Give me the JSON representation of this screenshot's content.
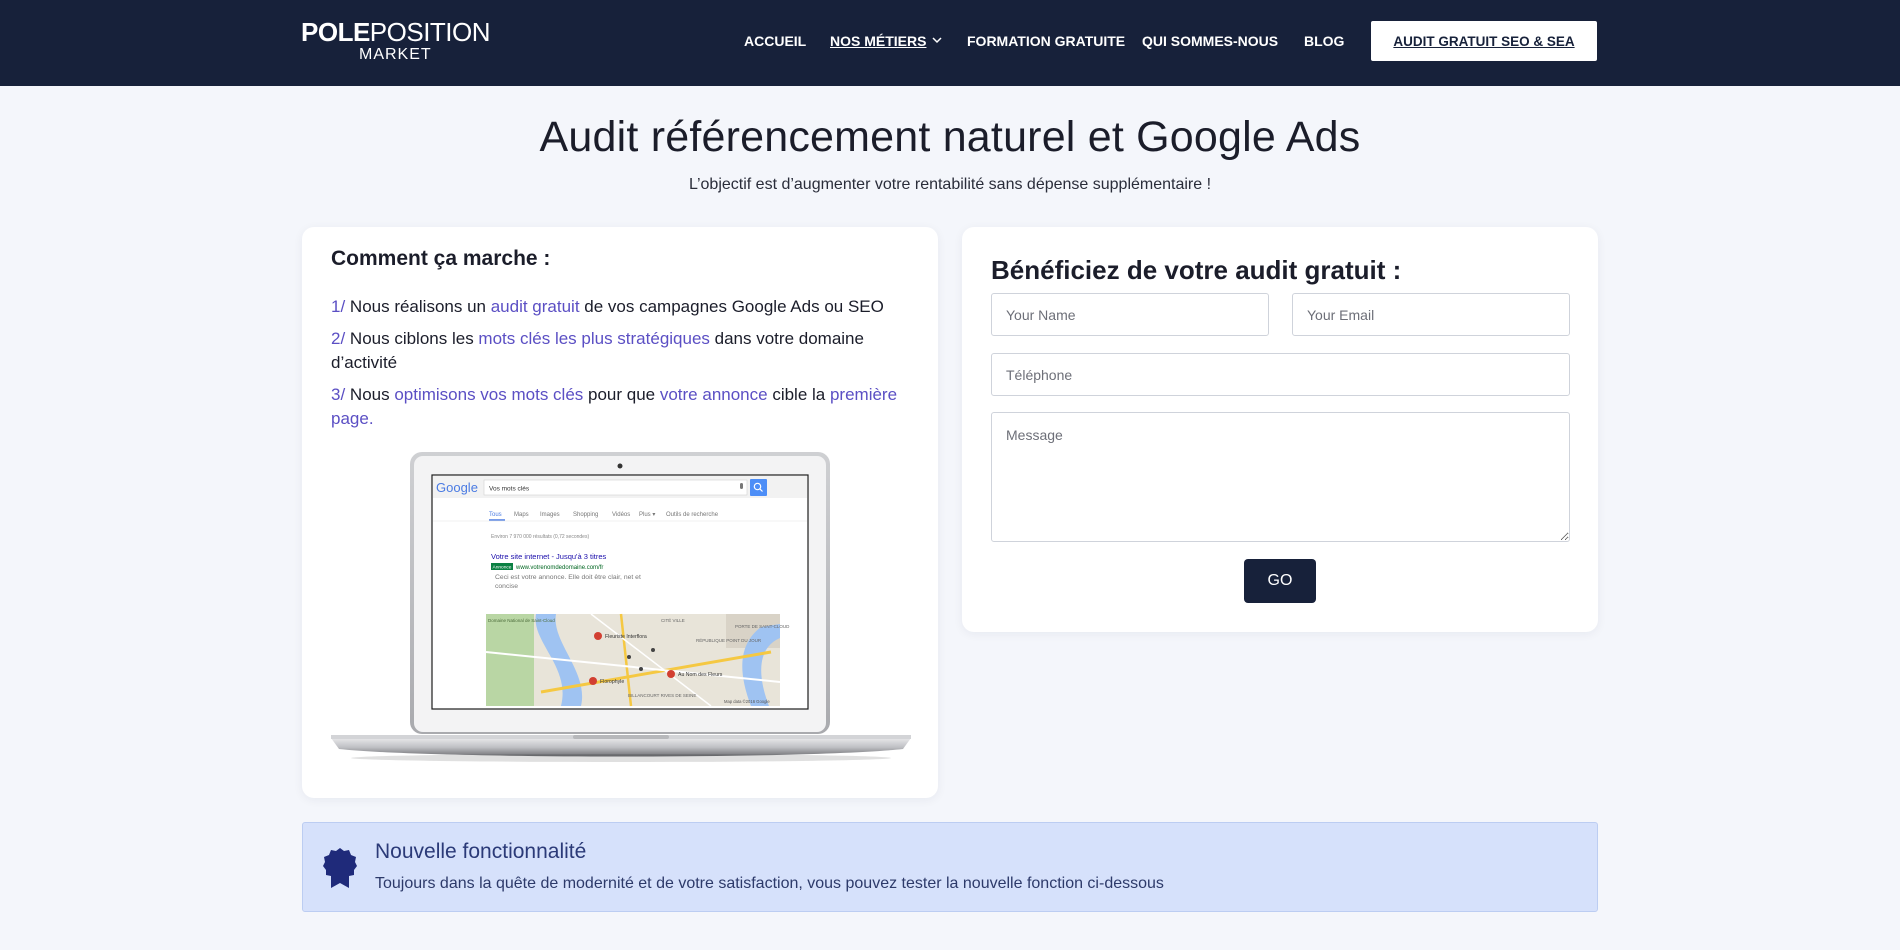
{
  "header": {
    "logo": {
      "line1_bold": "POLE",
      "line1_regular": "POSITION",
      "line2": "MARKET"
    },
    "nav": [
      {
        "label": "ACCUEIL"
      },
      {
        "label": "NOS MÉTIERS"
      },
      {
        "label": "FORMATION GRATUITE"
      },
      {
        "label": "QUI SOMMES-NOUS"
      },
      {
        "label": "BLOG"
      }
    ],
    "cta_label": "AUDIT GRATUIT SEO & SEA"
  },
  "hero": {
    "title": "Audit référencement naturel et Google Ads",
    "subtitle": "L’objectif est d’augmenter votre rentabilité sans dépense supplémentaire !"
  },
  "how": {
    "title": "Comment ça marche :",
    "step1": {
      "num": "1/",
      "a": " Nous réalisons un ",
      "b": "audit gratuit",
      "c": " de vos campagnes Google Ads ou SEO"
    },
    "step2": {
      "num": "2/",
      "a": " Nous ciblons les ",
      "b": "mots clés les plus stratégiques",
      "c": " dans votre domaine d’activité"
    },
    "step3": {
      "num": "3/",
      "a": " Nous ",
      "b": "optimisons vos mots clés",
      "c": " pour que ",
      "d": "votre annonce",
      "e": " cible la ",
      "f": "première page."
    }
  },
  "laptop_screen": {
    "google_logo": "Google",
    "search_value": "Vos mots clés",
    "tabs": [
      "Tous",
      "Maps",
      "Images",
      "Shopping",
      "Vidéos",
      "Plus ▾",
      "Outils de recherche"
    ],
    "results_count": "Environ 7 970 000 résultats (0,72 secondes)",
    "ad_title": "Votre site internet - Jusqu'à 3 titres",
    "ad_badge": "Annonce",
    "ad_url": "www.votrenomdedomaine.com/fr",
    "ad_desc_line1": "Ceci est votre annonce. Elle doit être clair, net et",
    "ad_desc_line2": "concise",
    "map_labels": [
      "Fleuriste Interflora",
      "Au Nom des Fleurs",
      "Florophyle",
      "CITÉ VILLE",
      "PORTE DE SAINT-CLOUD",
      "RÉPUBLIQUE POINT DU JOUR",
      "BILLANCOURT RIVES DE SEINE",
      "Domaine National de Saint-Cloud"
    ],
    "map_credit": "Map data ©2016 Google"
  },
  "form": {
    "title": "Bénéficiez de votre audit gratuit :",
    "name_placeholder": "Your Name",
    "email_placeholder": "Your Email",
    "phone_placeholder": "Téléphone",
    "message_placeholder": "Message",
    "submit_label": "GO"
  },
  "notice": {
    "title": "Nouvelle fonctionnalité",
    "text": "Toujours dans la quête de modernité et de votre satisfaction, vous pouvez tester la nouvelle fonction ci-dessous"
  },
  "colors": {
    "header_bg": "#17213a",
    "accent_purple": "#5b4fc4",
    "notice_bg": "#d6e1fb",
    "notice_text": "#2b3a78",
    "page_bg": "#f4f6fb"
  }
}
